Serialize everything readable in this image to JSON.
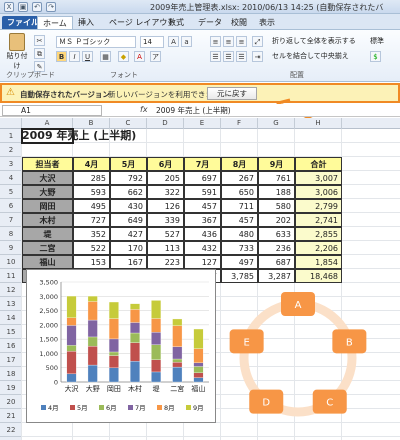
{
  "title_bar": {
    "title": "2009年売上管理表.xlsx: 2010/06/13 14:25 (自動保存されたバ"
  },
  "ribbon": {
    "tabs": [
      "ファイル",
      "ホーム",
      "挿入",
      "ページ レイアウト",
      "数式",
      "データ",
      "校閲",
      "表示"
    ],
    "paste_label": "貼り付け",
    "font_name": "ＭＳ Ｐゴシック",
    "font_size": "14",
    "wrap_text": "折り返して全体を表示する",
    "merge_center": "セルを結合して中央揃え",
    "number_format": "標準",
    "groups": {
      "clipboard": "クリップボード",
      "font": "フォント",
      "alignment": "配置"
    }
  },
  "notice": {
    "label": "自動保存されたバージョン",
    "message": "新しいバージョンを利用できます。",
    "button": "元に戻す"
  },
  "formula_bar": {
    "cell_ref": "A1",
    "fx": "fx",
    "formula": "2009 年売上 (上半期)"
  },
  "columns": [
    "A",
    "B",
    "C",
    "D",
    "E",
    "F",
    "G",
    "H"
  ],
  "rows": [
    "1",
    "2",
    "3",
    "4",
    "5",
    "6",
    "7",
    "8",
    "9",
    "10",
    "11",
    "12",
    "13",
    "14",
    "15",
    "16",
    "17",
    "18",
    "19",
    "20",
    "21",
    "22"
  ],
  "sheet": {
    "title": "2009 年売上 (上半期)",
    "headers": [
      "担当者",
      "4月",
      "5月",
      "6月",
      "7月",
      "8月",
      "9月",
      "合計"
    ],
    "data": [
      [
        "大沢",
        "285",
        "792",
        "205",
        "697",
        "267",
        "761",
        "3,007"
      ],
      [
        "大野",
        "593",
        "662",
        "322",
        "591",
        "650",
        "188",
        "3,006"
      ],
      [
        "岡田",
        "495",
        "430",
        "126",
        "457",
        "711",
        "580",
        "2,799"
      ],
      [
        "木村",
        "727",
        "649",
        "339",
        "367",
        "457",
        "202",
        "2,741"
      ],
      [
        "堤",
        "352",
        "427",
        "527",
        "436",
        "480",
        "633",
        "2,855"
      ],
      [
        "二宮",
        "522",
        "170",
        "113",
        "432",
        "733",
        "236",
        "2,206"
      ],
      [
        "福山",
        "153",
        "167",
        "223",
        "127",
        "497",
        "687",
        "1,854"
      ],
      [
        "合計",
        "3,127",
        "3,297",
        "1,855",
        "3,107",
        "3,785",
        "3,287",
        "18,468"
      ]
    ]
  },
  "chart_data": {
    "type": "bar",
    "stacked": true,
    "categories": [
      "大沢",
      "大野",
      "岡田",
      "木村",
      "堤",
      "二宮",
      "福山"
    ],
    "series": [
      {
        "name": "4月",
        "color": "#4f81bd",
        "values": [
          285,
          593,
          495,
          727,
          352,
          522,
          153
        ]
      },
      {
        "name": "5月",
        "color": "#c0504d",
        "values": [
          792,
          662,
          430,
          649,
          427,
          170,
          167
        ]
      },
      {
        "name": "6月",
        "color": "#9bbb59",
        "values": [
          205,
          322,
          126,
          339,
          527,
          113,
          223
        ]
      },
      {
        "name": "7月",
        "color": "#8064a2",
        "values": [
          697,
          591,
          457,
          367,
          436,
          432,
          127
        ]
      },
      {
        "name": "8月",
        "color": "#f79646",
        "values": [
          267,
          650,
          711,
          457,
          480,
          733,
          497
        ]
      },
      {
        "name": "9月",
        "color": "#c6cb3a",
        "values": [
          761,
          188,
          580,
          202,
          633,
          236,
          687
        ]
      }
    ],
    "yticks": [
      "0",
      "500",
      "1,000",
      "1,500",
      "2,000",
      "2,500",
      "3,000",
      "3,500"
    ],
    "ylim": [
      0,
      3500
    ]
  },
  "smartart": {
    "nodes": [
      "A",
      "B",
      "C",
      "D",
      "E"
    ],
    "node_color": "#f79646",
    "ring_color": "#fbe0c8"
  }
}
